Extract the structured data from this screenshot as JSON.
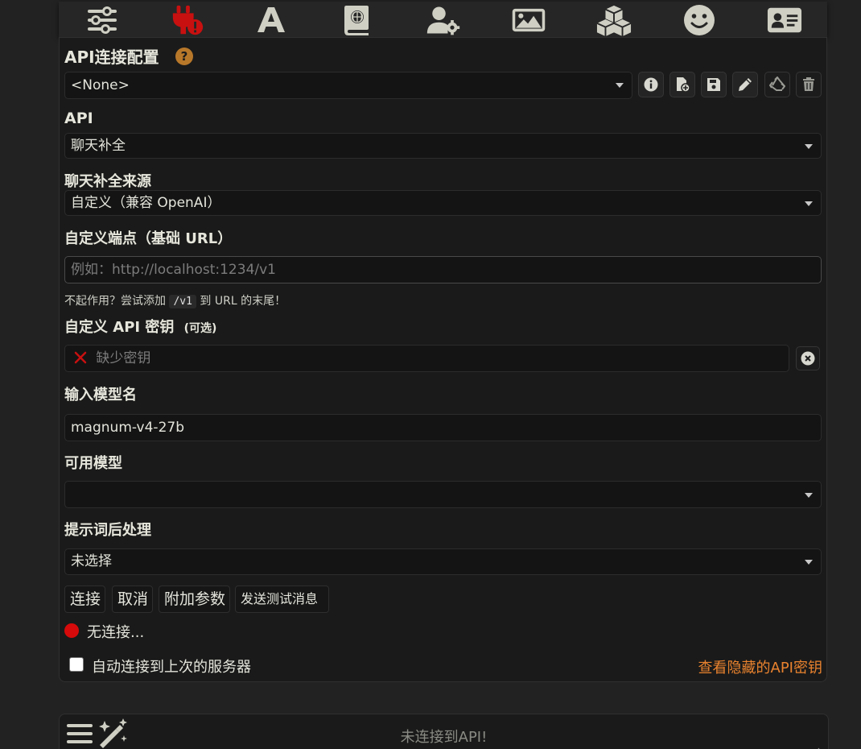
{
  "toolbar": {
    "icons": [
      "sliders-icon",
      "plug-warning-icon",
      "font-icon",
      "book-globe-icon",
      "user-gear-icon",
      "image-icon",
      "cubes-icon",
      "smile-icon",
      "id-card-icon"
    ]
  },
  "connection_profile": {
    "title": "API连接配置",
    "help": "?",
    "selected": "<None>"
  },
  "api": {
    "label": "API",
    "selected": "聊天补全"
  },
  "source": {
    "label": "聊天补全来源",
    "selected": "自定义（兼容 OpenAI）"
  },
  "endpoint": {
    "label": "自定义端点（基础 URL）",
    "placeholder": "例如：http://localhost:1234/v1",
    "hint_before": "不起作用？尝试添加",
    "hint_code": "/v1",
    "hint_after": "到 URL 的末尾！"
  },
  "api_key": {
    "label": "自定义 API 密钥",
    "optional": "(可选)",
    "status": "缺少密钥"
  },
  "model_name": {
    "label": "输入模型名",
    "value": "magnum-v4-27b"
  },
  "available_models": {
    "label": "可用模型",
    "selected": ""
  },
  "postprocess": {
    "label": "提示词后处理",
    "selected": "未选择"
  },
  "buttons": {
    "connect": "连接",
    "cancel": "取消",
    "extra_params": "附加参数",
    "send_test": "发送测试消息"
  },
  "status": {
    "text": "无连接...",
    "dot_color": "#d60a0a"
  },
  "auto_connect": {
    "label": "自动连接到上次的服务器",
    "checked": false
  },
  "view_hidden_keys": "查看隐藏的API密钥",
  "bottom": {
    "placeholder": "未连接到API!"
  },
  "colors": {
    "accent_orange": "#e8822e",
    "error_red": "#c81010",
    "help_badge": "#b8782a"
  }
}
